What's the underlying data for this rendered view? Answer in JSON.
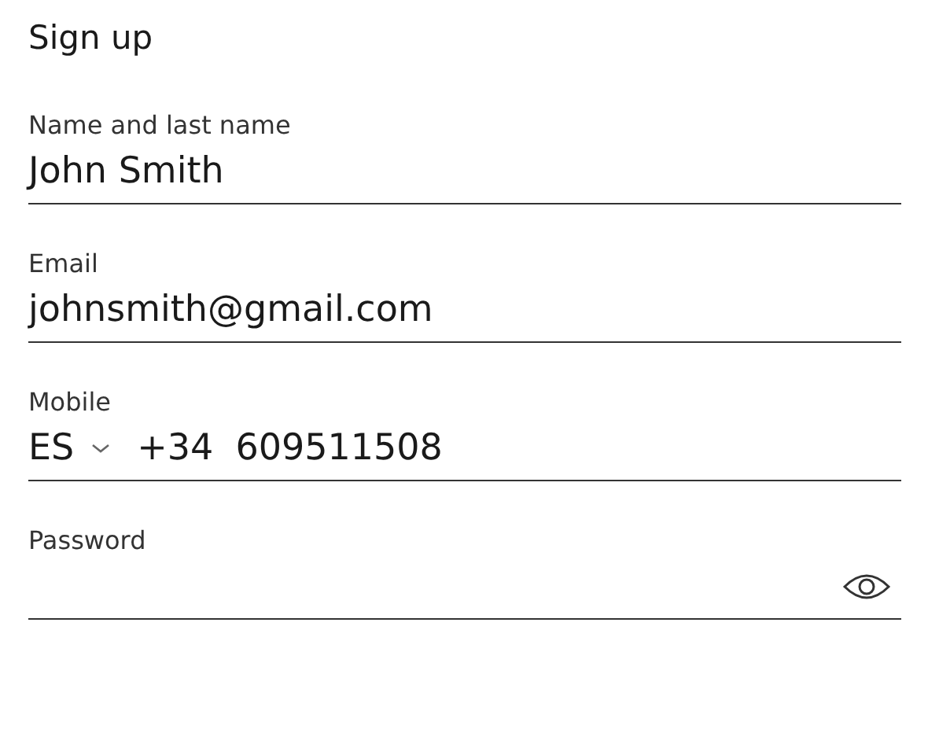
{
  "title": "Sign up",
  "fields": [
    {
      "kind": "text",
      "label": "Name and last name",
      "value": "John Smith"
    },
    {
      "kind": "text",
      "label": "Email",
      "value": "johnsmith@gmail.com"
    },
    {
      "kind": "phone",
      "label": "Mobile",
      "country": "ES",
      "prefix": "+34",
      "value": "609511508"
    },
    {
      "kind": "password",
      "label": "Password"
    }
  ]
}
